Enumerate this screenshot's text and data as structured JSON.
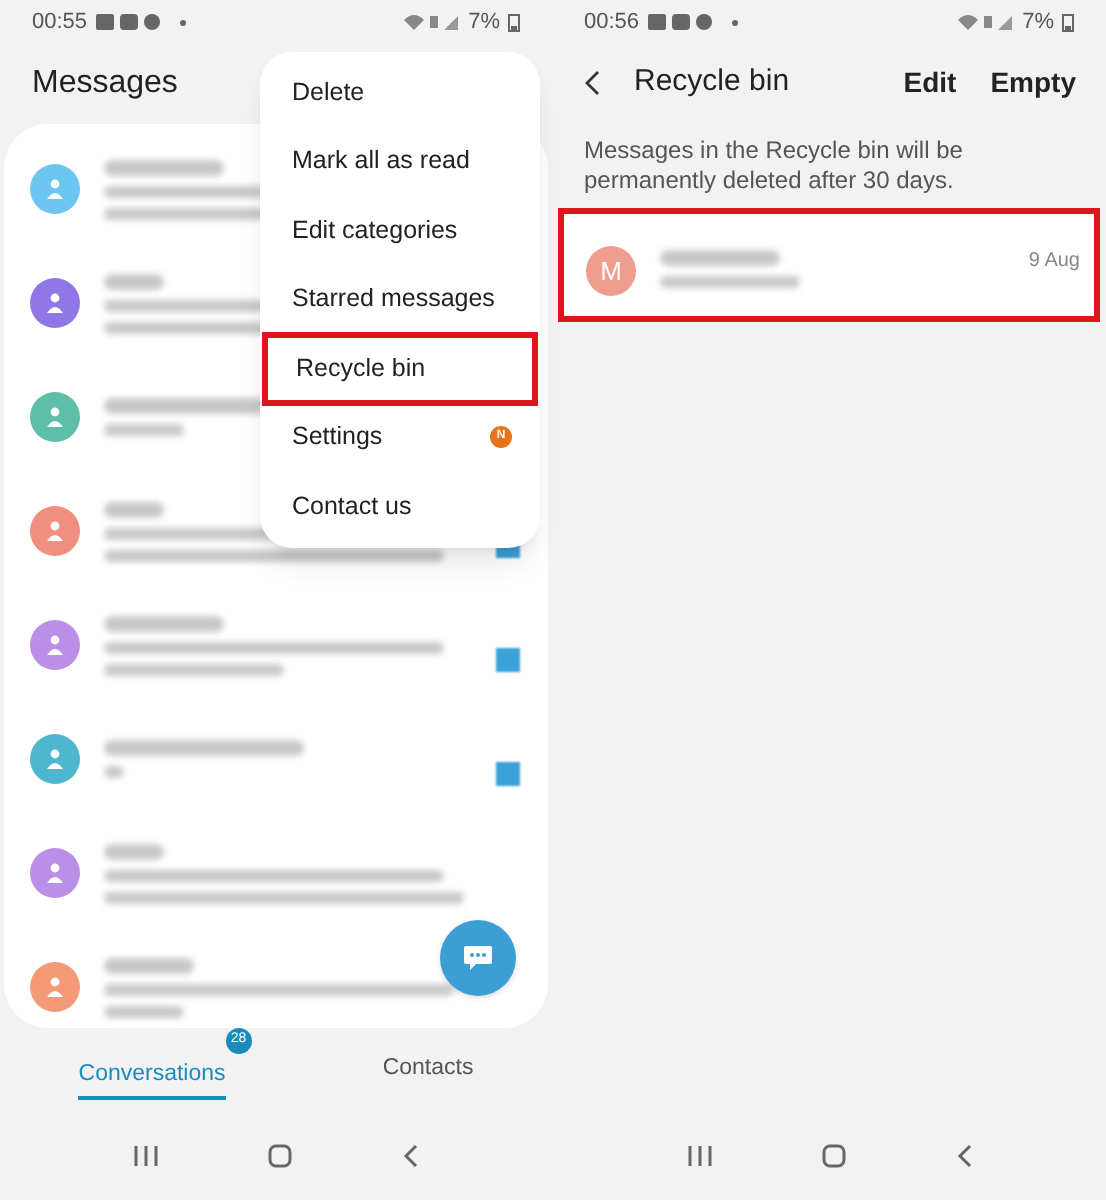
{
  "left_screen": {
    "status_bar": {
      "time": "00:55",
      "battery": "7%"
    },
    "title": "Messages",
    "conversations": [
      {
        "color": "#6cc6f2",
        "unread": false
      },
      {
        "color": "#8f78e6",
        "unread": false
      },
      {
        "color": "#5dbfa8",
        "unread": false
      },
      {
        "color": "#ef8f80",
        "unread": true
      },
      {
        "color": "#bb8ee8",
        "unread": true
      },
      {
        "color": "#4fb6d0",
        "unread": true
      },
      {
        "color": "#bb8ee8",
        "unread": false
      },
      {
        "color": "#f59a76",
        "unread": false
      }
    ],
    "menu": [
      {
        "label": "Delete",
        "selected": false
      },
      {
        "label": "Mark all as read",
        "selected": false
      },
      {
        "label": "Edit categories",
        "selected": false
      },
      {
        "label": "Starred messages",
        "selected": false
      },
      {
        "label": "Recycle bin",
        "selected": true
      },
      {
        "label": "Settings",
        "selected": false,
        "badge": "N"
      },
      {
        "label": "Contact us",
        "selected": false
      }
    ],
    "tabs": [
      {
        "label": "Conversations",
        "selected": true,
        "badge": "28"
      },
      {
        "label": "Contacts",
        "selected": false
      }
    ]
  },
  "right_screen": {
    "status_bar": {
      "time": "00:56",
      "battery": "7%"
    },
    "title": "Recycle bin",
    "actions": [
      "Edit",
      "Empty"
    ],
    "notice": "Messages in the Recycle bin will be permanently deleted after 30 days.",
    "messages": [
      {
        "initial": "M",
        "date": "9 Aug",
        "selected": true
      }
    ]
  }
}
